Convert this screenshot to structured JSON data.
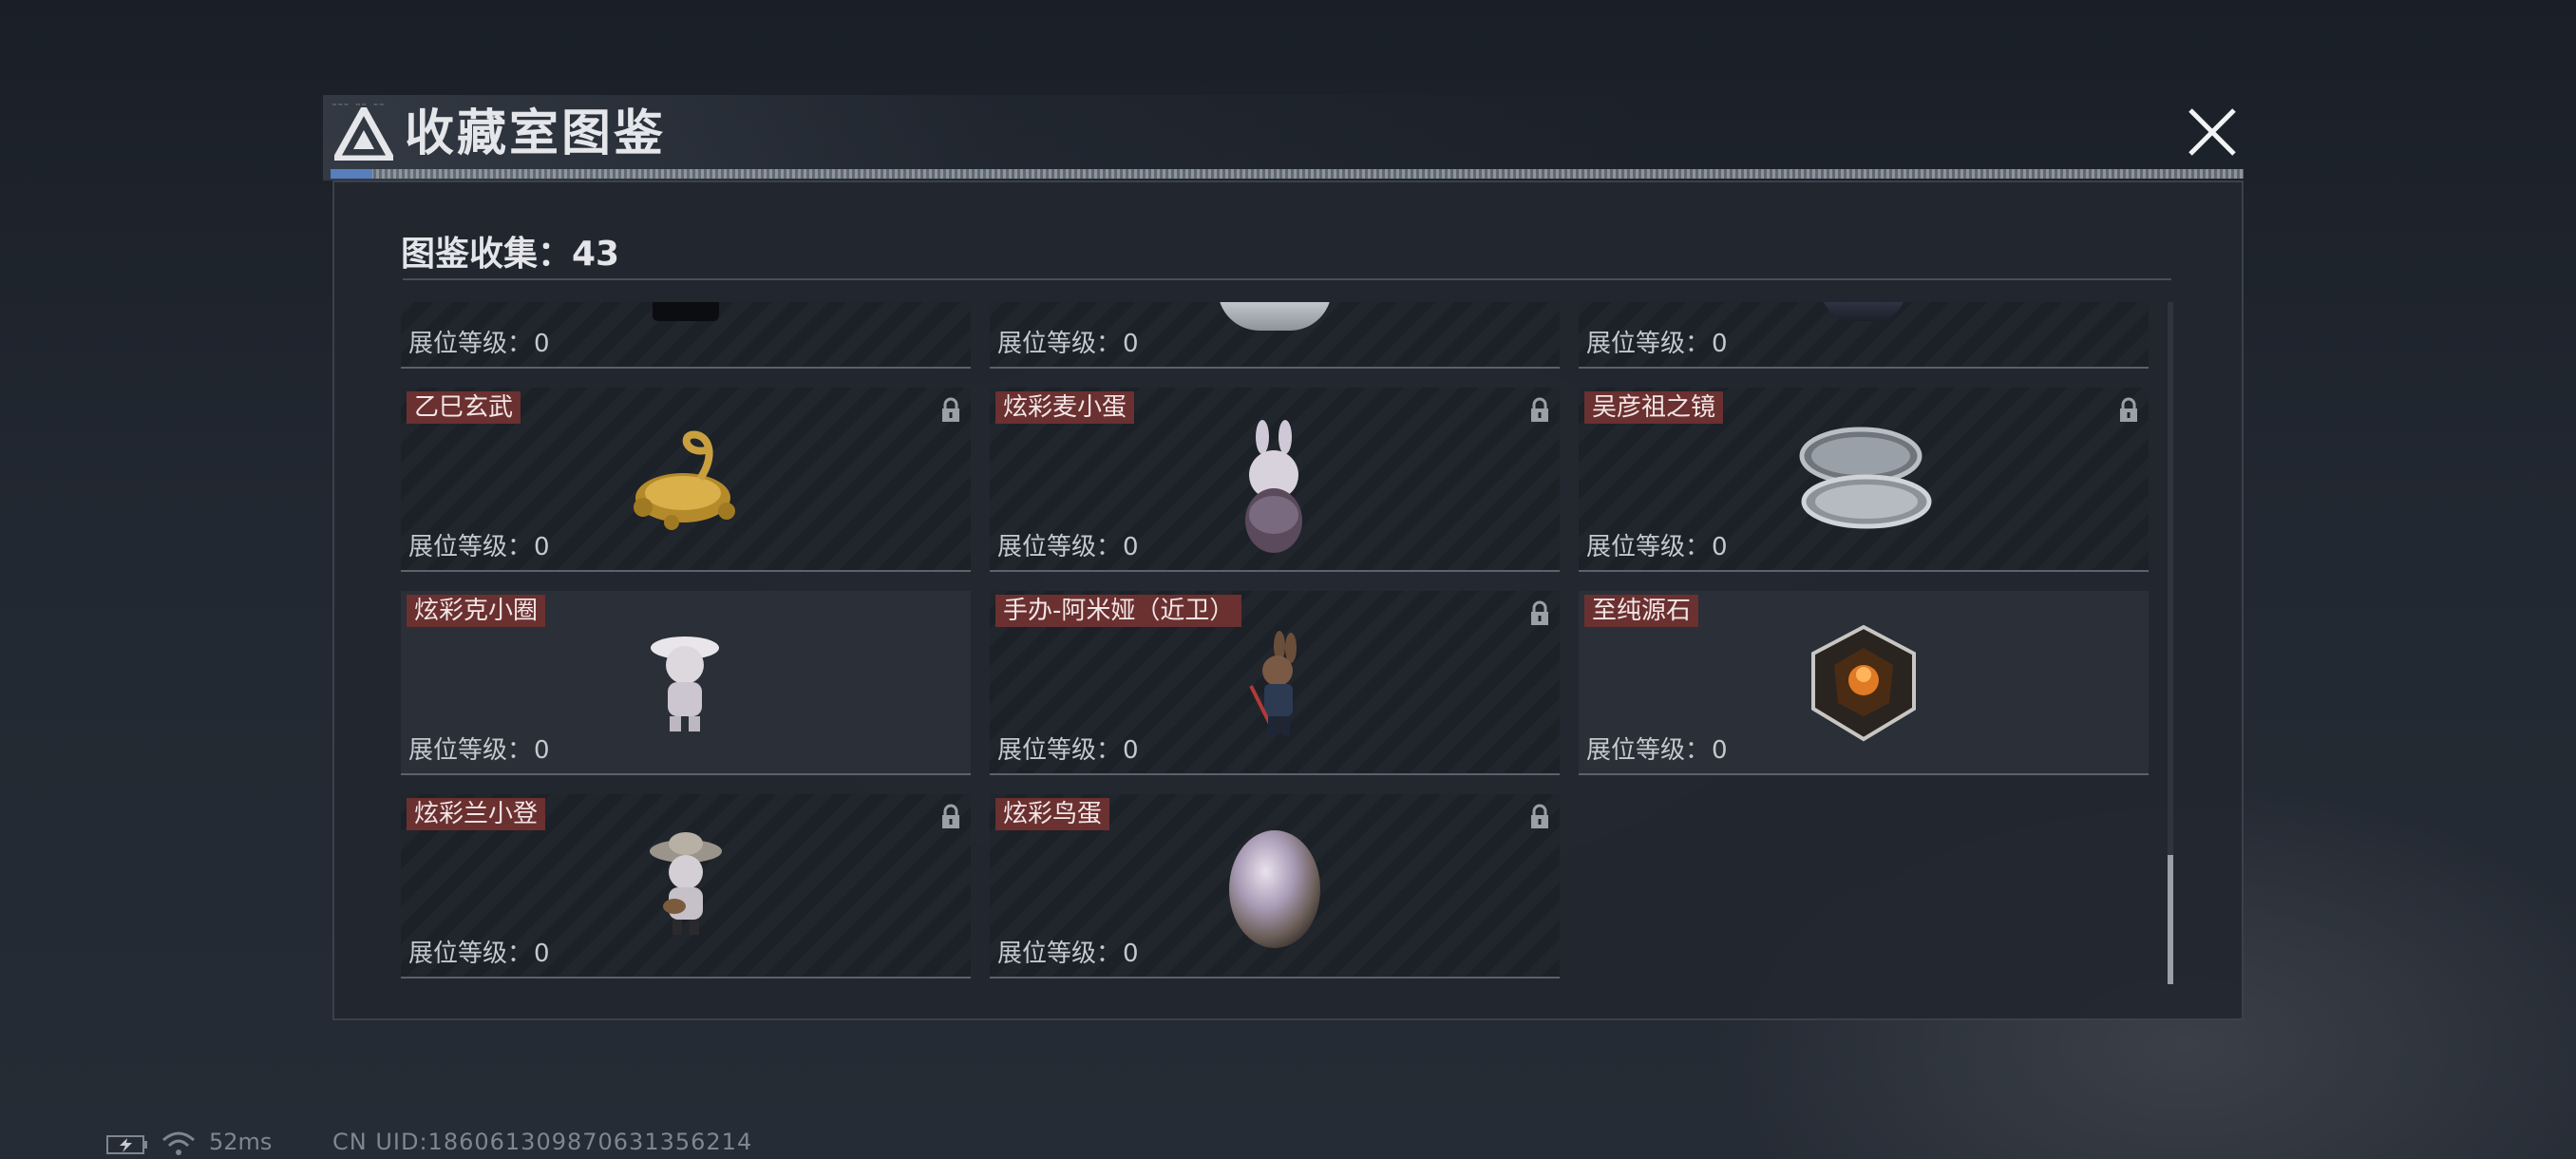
{
  "window": {
    "title": "收藏室图鉴"
  },
  "collection": {
    "label": "图鉴收集：43"
  },
  "level_label": "展位等级：",
  "top_row": [
    {
      "level": "0"
    },
    {
      "level": "0"
    },
    {
      "level": "0"
    }
  ],
  "items": [
    {
      "name": "乙巳玄武",
      "level": "0",
      "locked": true,
      "icon": "golden-dragon-turtle"
    },
    {
      "name": "炫彩麦小蛋",
      "level": "0",
      "locked": true,
      "icon": "bunny-egg-figure"
    },
    {
      "name": "吴彦祖之镜",
      "level": "0",
      "locked": true,
      "icon": "compact-mirror"
    },
    {
      "name": "炫彩克小圈",
      "level": "0",
      "locked": false,
      "icon": "hat-figure"
    },
    {
      "name": "手办-阿米娅（近卫）",
      "level": "0",
      "locked": true,
      "icon": "amiya-figure"
    },
    {
      "name": "至纯源石",
      "level": "0",
      "locked": false,
      "icon": "originium-crystal"
    },
    {
      "name": "炫彩兰小登",
      "level": "0",
      "locked": true,
      "icon": "sombrero-figure"
    },
    {
      "name": "炫彩鸟蛋",
      "level": "0",
      "locked": true,
      "icon": "iridescent-egg"
    }
  ],
  "status": {
    "ping": "52ms",
    "uid": "CN UID:186061309870631356214"
  },
  "colors": {
    "name_tag": "#6b3030",
    "scroll_thumb": "#9ba1aa",
    "accent_line": "#5f8bd1"
  }
}
